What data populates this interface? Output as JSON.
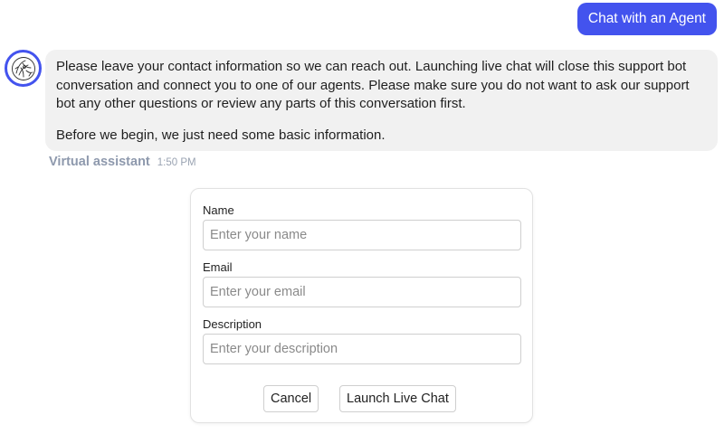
{
  "user_message": {
    "text": "Chat with an Agent"
  },
  "bot": {
    "avatar_icon": "assistant-sketch-icon",
    "paragraphs": [
      "Please leave your contact information so we can reach out. Launching live chat will close this support bot conversation and connect you to one of our agents. Please make sure you do not want to ask our support bot any other questions or review any parts of this conversation first.",
      "Before we begin, we just need some basic information."
    ],
    "sender_name": "Virtual assistant",
    "timestamp": "1:50 PM"
  },
  "form": {
    "fields": [
      {
        "label": "Name",
        "placeholder": "Enter your name",
        "value": ""
      },
      {
        "label": "Email",
        "placeholder": "Enter your email",
        "value": ""
      },
      {
        "label": "Description",
        "placeholder": "Enter your description",
        "value": ""
      }
    ],
    "cancel_label": "Cancel",
    "launch_label": "Launch Live Chat"
  },
  "colors": {
    "accent": "#4353ee",
    "bot_bubble_bg": "#f1f1f1",
    "meta_text": "#8e99ad"
  }
}
